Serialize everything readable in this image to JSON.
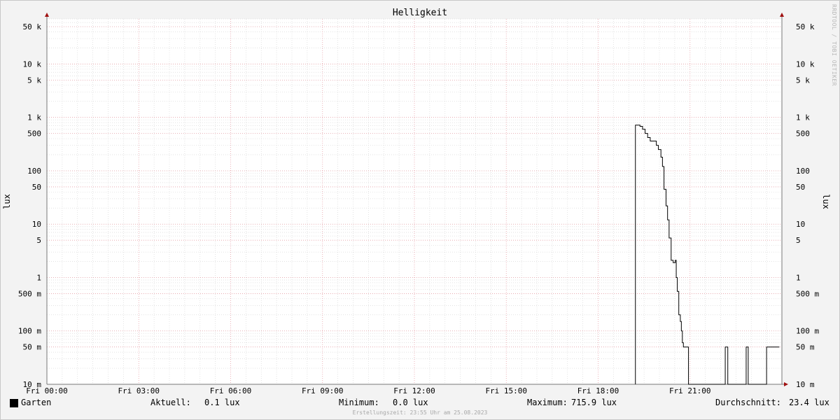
{
  "title": "Helligkeit",
  "watermark": "RRDTOOL / TOBI OETIKER",
  "chart_data": {
    "type": "line",
    "title": "Helligkeit",
    "ylabel": "lux",
    "ylabel_right": "lux",
    "yscale": "log",
    "ylim": [
      0.01,
      70000
    ],
    "xlim": [
      "00:00",
      "24:00"
    ],
    "x_ticks": [
      "Fri 00:00",
      "Fri 03:00",
      "Fri 06:00",
      "Fri 09:00",
      "Fri 12:00",
      "Fri 15:00",
      "Fri 18:00",
      "Fri 21:00"
    ],
    "y_ticks": [
      {
        "value": 0.01,
        "label": "10 m"
      },
      {
        "value": 0.05,
        "label": "50 m"
      },
      {
        "value": 0.1,
        "label": "100 m"
      },
      {
        "value": 0.5,
        "label": "500 m"
      },
      {
        "value": 1,
        "label": "1"
      },
      {
        "value": 5,
        "label": "5"
      },
      {
        "value": 10,
        "label": "10"
      },
      {
        "value": 50,
        "label": "50"
      },
      {
        "value": 100,
        "label": "100"
      },
      {
        "value": 500,
        "label": "500"
      },
      {
        "value": 1000,
        "label": "1 k"
      },
      {
        "value": 5000,
        "label": "5 k"
      },
      {
        "value": 10000,
        "label": "10 k"
      },
      {
        "value": 50000,
        "label": "50 k"
      }
    ],
    "grid": true,
    "series": [
      {
        "name": "Garten",
        "color": "#000000",
        "points": [
          [
            "19:13",
            0.01
          ],
          [
            "19:13",
            715.9
          ],
          [
            "19:22",
            715.9
          ],
          [
            "19:22",
            680
          ],
          [
            "19:27",
            680
          ],
          [
            "19:27",
            600
          ],
          [
            "19:32",
            600
          ],
          [
            "19:32",
            500
          ],
          [
            "19:37",
            500
          ],
          [
            "19:37",
            420
          ],
          [
            "19:42",
            420
          ],
          [
            "19:42",
            360
          ],
          [
            "19:54",
            360
          ],
          [
            "19:54",
            300
          ],
          [
            "19:58",
            300
          ],
          [
            "19:58",
            250
          ],
          [
            "20:03",
            250
          ],
          [
            "20:03",
            180
          ],
          [
            "20:06",
            180
          ],
          [
            "20:06",
            120
          ],
          [
            "20:09",
            120
          ],
          [
            "20:09",
            45
          ],
          [
            "20:13",
            45
          ],
          [
            "20:13",
            22
          ],
          [
            "20:16",
            22
          ],
          [
            "20:16",
            12
          ],
          [
            "20:19",
            12
          ],
          [
            "20:19",
            5.5
          ],
          [
            "20:23",
            5.5
          ],
          [
            "20:23",
            2.1
          ],
          [
            "20:27",
            2.1
          ],
          [
            "20:27",
            1.9
          ],
          [
            "20:31",
            1.9
          ],
          [
            "20:31",
            2.1
          ],
          [
            "20:33",
            2.1
          ],
          [
            "20:33",
            1.0
          ],
          [
            "20:35",
            1.0
          ],
          [
            "20:35",
            0.55
          ],
          [
            "20:38",
            0.55
          ],
          [
            "20:38",
            0.2
          ],
          [
            "20:41",
            0.2
          ],
          [
            "20:41",
            0.15
          ],
          [
            "20:43",
            0.15
          ],
          [
            "20:43",
            0.1
          ],
          [
            "20:45",
            0.1
          ],
          [
            "20:45",
            0.06
          ],
          [
            "20:47",
            0.06
          ],
          [
            "20:47",
            0.05
          ],
          [
            "20:57",
            0.05
          ],
          [
            "20:57",
            0.01
          ],
          [
            "22:09",
            0.01
          ],
          [
            "22:09",
            0.05
          ],
          [
            "22:12",
            0.05
          ],
          [
            "22:12",
            0.05
          ],
          [
            "22:14",
            0.05
          ],
          [
            "22:14",
            0.01
          ],
          [
            "22:50",
            0.01
          ],
          [
            "22:50",
            0.05
          ],
          [
            "22:52",
            0.05
          ],
          [
            "22:52",
            0.05
          ],
          [
            "22:54",
            0.05
          ],
          [
            "22:54",
            0.01
          ],
          [
            "23:30",
            0.01
          ],
          [
            "23:30",
            0.05
          ],
          [
            "23:55",
            0.05
          ]
        ]
      }
    ]
  },
  "legend": {
    "series_name": "Garten",
    "current_label": "Aktuell:",
    "current_value": "0.1 lux",
    "min_label": "Minimum:",
    "min_value": "0.0 lux",
    "max_label": "Maximum:",
    "max_value": "715.9 lux",
    "avg_label": "Durchschnitt:",
    "avg_value": "23.4 lux"
  },
  "footer": "Erstellungszeit: 23:55 Uhr am 25.08.2023"
}
